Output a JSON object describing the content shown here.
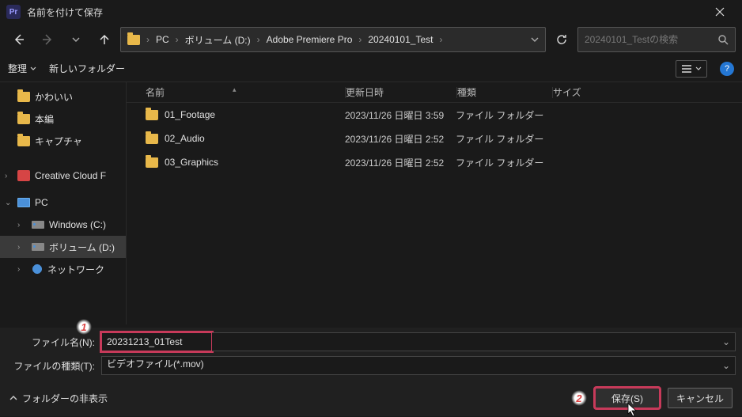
{
  "title": "名前を付けて保存",
  "breadcrumbs": [
    "PC",
    "ボリューム (D:)",
    "Adobe Premiere Pro",
    "20240101_Test"
  ],
  "search": {
    "placeholder": "20240101_Testの検索"
  },
  "toolbar": {
    "organize": "整理",
    "new_folder": "新しいフォルダー"
  },
  "columns": {
    "name": "名前",
    "date": "更新日時",
    "type": "種類",
    "size": "サイズ"
  },
  "tree": {
    "kawaii": "かわいい",
    "honpen": "本編",
    "capture": "キャプチャ",
    "ccf": "Creative Cloud F",
    "pc": "PC",
    "win": "Windows (C:)",
    "vol": "ボリューム (D:)",
    "net": "ネットワーク"
  },
  "rows": [
    {
      "name": "01_Footage",
      "date": "2023/11/26 日曜日 3:59",
      "type": "ファイル フォルダー"
    },
    {
      "name": "02_Audio",
      "date": "2023/11/26 日曜日 2:52",
      "type": "ファイル フォルダー"
    },
    {
      "name": "03_Graphics",
      "date": "2023/11/26 日曜日 2:52",
      "type": "ファイル フォルダー"
    }
  ],
  "fields": {
    "name_label": "ファイル名(N):",
    "name_value": "20231213_01Test",
    "type_label": "ファイルの種類(T):",
    "type_value": "ビデオファイル(*.mov)"
  },
  "footer": {
    "hide_folders": "フォルダーの非表示",
    "save": "保存(S)",
    "cancel": "キャンセル"
  },
  "annotations": {
    "b1": "1",
    "b2": "2"
  }
}
